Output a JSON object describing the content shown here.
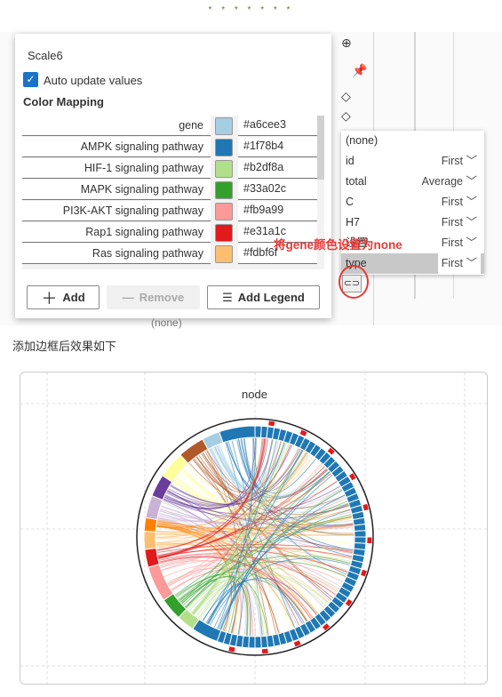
{
  "stars": "* * * * * * *",
  "panel": {
    "title": "Scale6",
    "auto_update_label": "Auto update values",
    "auto_update_checked": true,
    "section_title": "Color Mapping",
    "rows": [
      {
        "label": "gene",
        "color": "#a6cee3"
      },
      {
        "label": "AMPK signaling pathway",
        "color": "#1f78b4"
      },
      {
        "label": "HIF-1 signaling pathway",
        "color": "#b2df8a"
      },
      {
        "label": "MAPK signaling pathway",
        "color": "#33a02c"
      },
      {
        "label": "PI3K-AKT signaling pathway",
        "color": "#fb9a99"
      },
      {
        "label": "Rap1 signaling pathway",
        "color": "#e31a1c"
      },
      {
        "label": "Ras signaling pathway",
        "color": "#fdbf6f"
      }
    ],
    "add_label": "Add",
    "remove_label": "Remove",
    "add_legend_label": "Add Legend"
  },
  "dropdown": {
    "items": [
      {
        "name": "(none)",
        "agg": ""
      },
      {
        "name": "id",
        "agg": "First"
      },
      {
        "name": "total",
        "agg": "Average"
      },
      {
        "name": "C",
        "agg": "First"
      },
      {
        "name": "H7",
        "agg": "First"
      },
      {
        "name": "设置",
        "agg": "First"
      },
      {
        "name": "type",
        "agg": "First",
        "selected": true
      }
    ]
  },
  "behind_field": "(none)",
  "annotation": "将gene颜色设置为none",
  "caption": "添加边框后效果如下",
  "chart": {
    "title": "node",
    "ring_colors": [
      "#1f78b4",
      "#a6cee3",
      "#b15928",
      "#ffff99",
      "#6a3d9a",
      "#cab2d6",
      "#ff7f00",
      "#fdbf6f",
      "#e31a1c",
      "#fb9a99",
      "#33a02c",
      "#b2df8a",
      "#1f78b4"
    ],
    "gene_color": "#1f78b4",
    "accent": "#e31a1c"
  }
}
